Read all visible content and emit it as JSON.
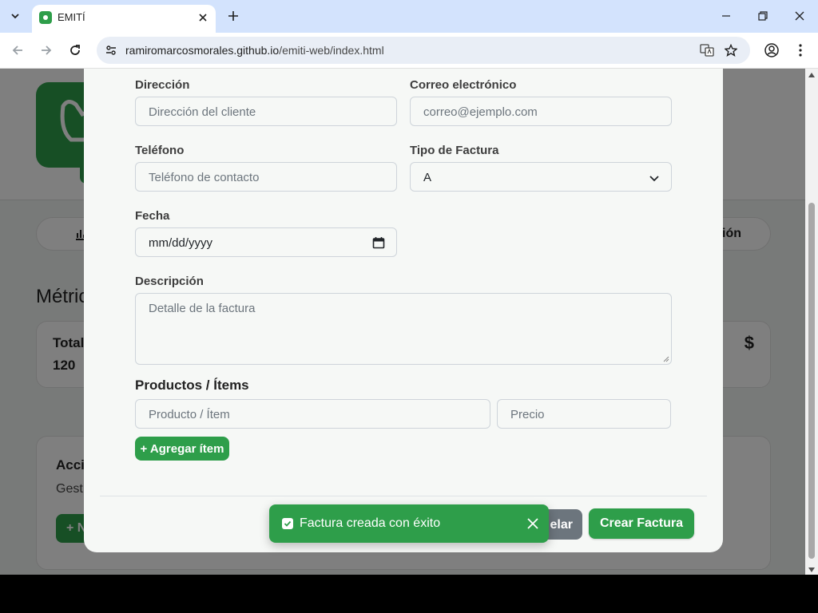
{
  "browser": {
    "tab_title": "EMITÍ",
    "url_domain": "ramiromarcosmorales.github.io",
    "url_path": "/emiti-web/index.html"
  },
  "background": {
    "nav_label_partial": "ión",
    "section_title_partial": "Métric",
    "card_label_partial": "Total",
    "card_value_partial": "120",
    "card_icon": "$",
    "actions_title_partial": "Acci",
    "actions_sub_partial": "Gest",
    "actions_btn_partial": "+ N"
  },
  "form": {
    "direccion_label": "Dirección",
    "direccion_placeholder": "Dirección del cliente",
    "correo_label": "Correo electrónico",
    "correo_placeholder": "correo@ejemplo.com",
    "telefono_label": "Teléfono",
    "telefono_placeholder": "Teléfono de contacto",
    "tipo_label": "Tipo de Factura",
    "tipo_value": "A",
    "fecha_label": "Fecha",
    "fecha_value": "mm/dd/yyyy",
    "descripcion_label": "Descripción",
    "descripcion_placeholder": "Detalle de la factura",
    "productos_title": "Productos / Ítems",
    "producto_placeholder": "Producto / Ítem",
    "precio_placeholder": "Precio",
    "add_item_label": "+ Agregar ítem",
    "cancel_label_partial": "elar",
    "create_label": "Crear Factura"
  },
  "toast": {
    "message": "Factura creada con éxito"
  },
  "colors": {
    "brand_green": "#2e9e4a",
    "cancel_gray": "#6c757d"
  }
}
